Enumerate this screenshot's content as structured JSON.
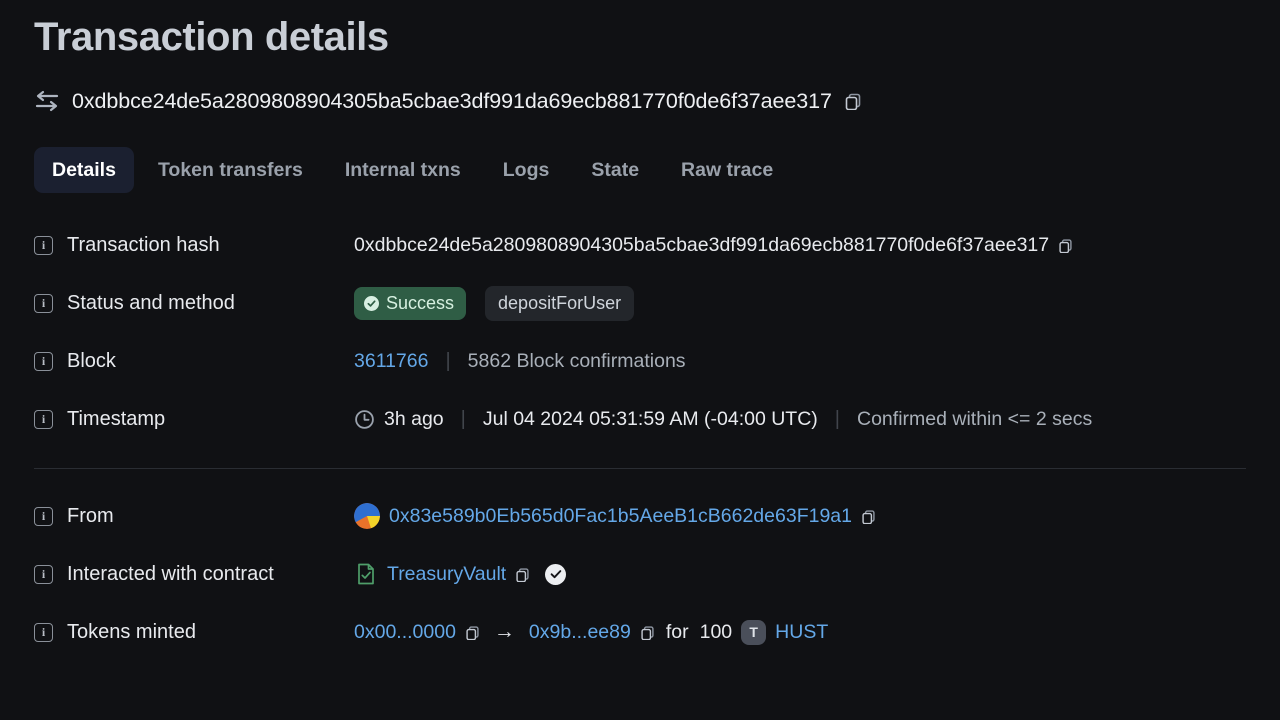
{
  "page": {
    "title": "Transaction details",
    "hash": "0xdbbce24de5a2809808904305ba5cbae3df991da69ecb881770f0de6f37aee317",
    "swap_icon": "swap-arrows-icon",
    "copy_icon": "copy-icon"
  },
  "tabs": [
    {
      "label": "Details",
      "active": true
    },
    {
      "label": "Token transfers",
      "active": false
    },
    {
      "label": "Internal txns",
      "active": false
    },
    {
      "label": "Logs",
      "active": false
    },
    {
      "label": "State",
      "active": false
    },
    {
      "label": "Raw trace",
      "active": false
    }
  ],
  "details": {
    "transaction_hash": {
      "label": "Transaction hash",
      "value": "0xdbbce24de5a2809808904305ba5cbae3df991da69ecb881770f0de6f37aee317"
    },
    "status_and_method": {
      "label": "Status and method",
      "status": "Success",
      "method": "depositForUser"
    },
    "block": {
      "label": "Block",
      "number": "3611766",
      "confirmations": "5862 Block confirmations"
    },
    "timestamp": {
      "label": "Timestamp",
      "relative": "3h ago",
      "absolute": "Jul 04 2024 05:31:59 AM (-04:00 UTC)",
      "confirmed": "Confirmed within <= 2 secs"
    },
    "from": {
      "label": "From",
      "address": "0x83e589b0Eb565d0Fac1b5AeeB1cB662de63F19a1"
    },
    "interacted_with_contract": {
      "label": "Interacted with contract",
      "name": "TreasuryVault",
      "verified_icon": "verified-check-icon",
      "contract_icon": "contract-document-icon"
    },
    "tokens_minted": {
      "label": "Tokens minted",
      "from_address": "0x00...0000",
      "to_address": "0x9b...ee89",
      "for_word": "for",
      "amount": "100",
      "token_symbol": "HUST",
      "token_badge_letter": "T"
    }
  },
  "colors": {
    "background": "#101114",
    "link": "#64a8e8",
    "success_badge_bg": "#2f5d45",
    "active_tab_bg": "#1b2030",
    "contract_green": "#4f9e6a"
  }
}
